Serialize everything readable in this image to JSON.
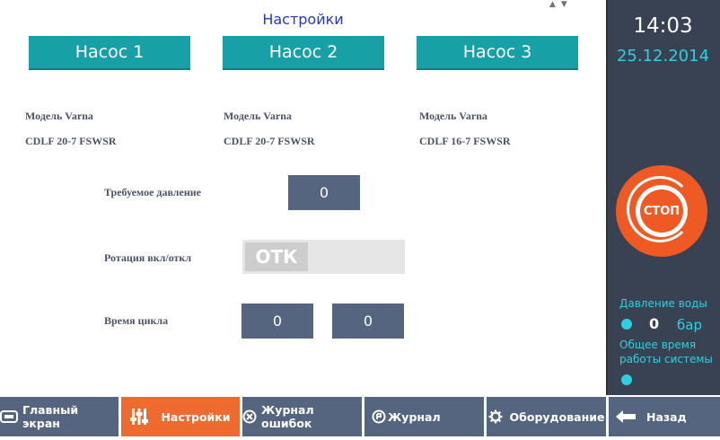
{
  "header": {
    "title": "Настройки",
    "scroll_arrows": "▲▼"
  },
  "pumps": [
    {
      "label": "Насос 1",
      "model_line1": "Модель Varna",
      "model_line2": "CDLF 20-7 FSWSR"
    },
    {
      "label": "Насос 2",
      "model_line1": "Модель Varna",
      "model_line2": "CDLF 20-7 FSWSR"
    },
    {
      "label": "Насос 3",
      "model_line1": "Модель Varna",
      "model_line2": "CDLF 16-7 FSWSR"
    }
  ],
  "settings": {
    "required_pressure_label": "Требуемое давление",
    "required_pressure_value": "0",
    "rotation_label": "Ротация вкл/откл",
    "rotation_state": "ОТК",
    "cycle_time_label": "Время цикла",
    "cycle_time_value1": "0",
    "cycle_time_value2": "0"
  },
  "sidebar": {
    "time": "14:03",
    "date": "25.12.2014",
    "stop_label": "СТОП",
    "water_pressure_label": "Давление воды",
    "water_pressure_value": "0",
    "water_pressure_unit": "бар",
    "total_runtime_label_line1": "Общее время",
    "total_runtime_label_line2": "работы системы"
  },
  "nav": {
    "main_screen": "Главный экран",
    "settings": "Настройки",
    "error_log": "Журнал ошибок",
    "journal": "Журнал",
    "equipment": "Оборудование",
    "back": "Назад"
  },
  "colors": {
    "accent_teal": "#17a1a6",
    "value_box": "#56657f",
    "sidebar_bg": "#394253",
    "stop_orange": "#ef5a24",
    "active_tab": "#ef6a2e",
    "cyan_text": "#2ed0e0"
  }
}
